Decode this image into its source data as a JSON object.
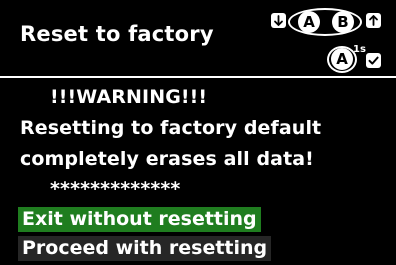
{
  "header": {
    "title": "Reset to factory",
    "controls": {
      "down_icon": "arrow-down-icon",
      "up_icon": "arrow-up-icon",
      "button_a_label": "A",
      "button_b_label": "B",
      "confirm_button_label": "A",
      "long_press_label": "1s",
      "confirm_icon": "checkmark-icon"
    }
  },
  "warning": {
    "heading": "!!!WARNING!!!",
    "line1": "Resetting to factory default",
    "line2": "completely erases all data!",
    "stars": "*************"
  },
  "menu": {
    "items": [
      {
        "label": "Exit without resetting",
        "selected": true
      },
      {
        "label": "Proceed with resetting",
        "selected": false
      }
    ]
  },
  "colors": {
    "background": "#000000",
    "text": "#ffffff",
    "selected_bg": "#1f7d1f",
    "item_bg": "#262626"
  }
}
